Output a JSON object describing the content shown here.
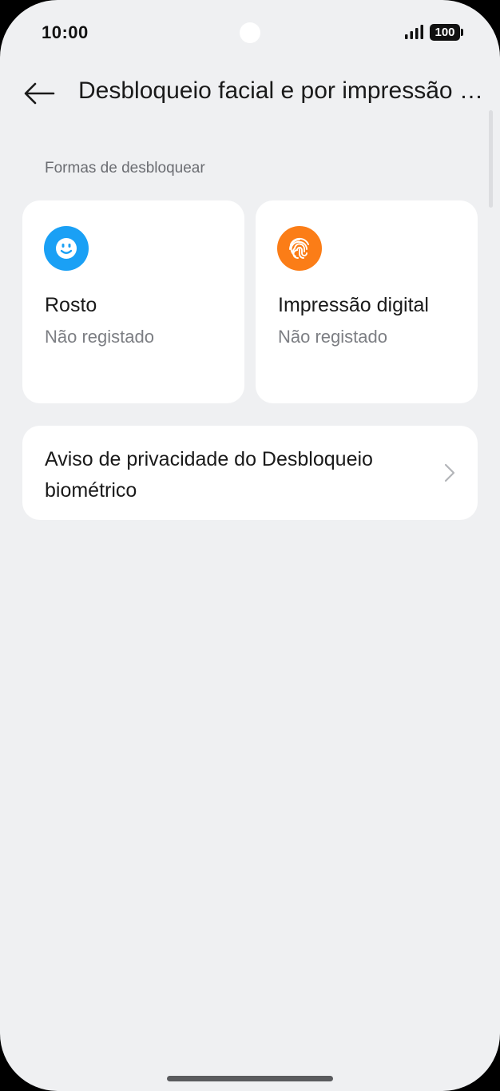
{
  "status_bar": {
    "time": "10:00",
    "battery": "100"
  },
  "header": {
    "title": "Desbloqueio facial e por impressão digital"
  },
  "section": {
    "label": "Formas de desbloquear"
  },
  "cards": {
    "face": {
      "title": "Rosto",
      "status": "Não registado",
      "icon": "face-icon",
      "color": "#1aa0f5"
    },
    "fingerprint": {
      "title": "Impressão digital",
      "status": "Não registado",
      "icon": "fingerprint-icon",
      "color": "#fb7d17"
    }
  },
  "privacy": {
    "label": "Aviso de privacidade do Desbloqueio biométrico"
  }
}
